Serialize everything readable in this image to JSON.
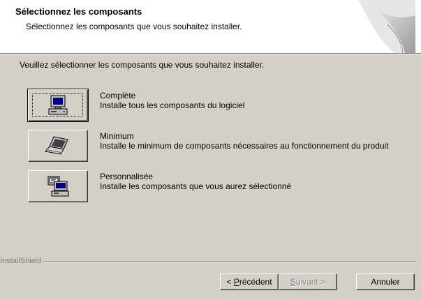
{
  "header": {
    "title": "Sélectionnez les composants",
    "subtitle": "Sélectionnez les composants que vous souhaitez installer."
  },
  "intro": "Veuillez sélectionner les composants que vous souhaitez installer.",
  "options": [
    {
      "name": "Complète",
      "description": "Installe tous les composants du logiciel",
      "icon": "desktop-computer-icon",
      "selected": true
    },
    {
      "name": "Minimum",
      "description": "Installe le minimum de composants nécessaires au fonctionnement du produit",
      "icon": "laptop-icon",
      "selected": false
    },
    {
      "name": "Personnalisée",
      "description": "Installe les composants que vous aurez sélectionné",
      "icon": "custom-computer-icon",
      "selected": false
    }
  ],
  "brand": "InstallShield",
  "buttons": {
    "back_prefix": "< ",
    "back_key": "P",
    "back_rest": "récédent",
    "next_key": "S",
    "next_rest": "uivant >",
    "cancel": "Annuler"
  }
}
